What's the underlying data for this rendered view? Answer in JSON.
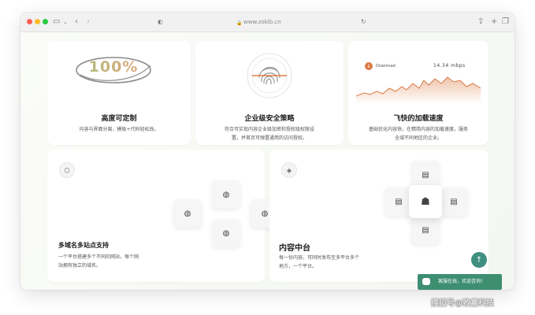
{
  "browser": {
    "url": "www.zoklb.cn",
    "icons": {
      "back": "chevron-left-icon",
      "forward": "chevron-right-icon",
      "share": "share-icon",
      "new_tab": "plus-icon",
      "tabs": "tabs-icon",
      "lock": "lock-icon",
      "reload": "reload-icon",
      "sidebar": "sidebar-icon"
    }
  },
  "cards": {
    "custom": {
      "badge": "100%",
      "title": "高度可定制",
      "desc": "内容与界面分离，模板+代码轻松改。"
    },
    "security": {
      "title": "企业级安全策略",
      "desc_line1": "符合可实现内容企业级加密和授权级权限设",
      "desc_line2": "置，并首页可弹置通用的访问授权。"
    },
    "speed": {
      "legend": "Download",
      "value": "14.34 mbps",
      "title": "飞快的加载速度",
      "desc_line1": "基础优化内容快，在精简内容的加载速度，服务",
      "desc_line2": "全域不同地区的企业。"
    },
    "multisite": {
      "title": "多域名多站点支持",
      "desc_line1": "一个平台搭建多个不同的网站，每个网",
      "desc_line2": "站拥有独立的域名。"
    },
    "cms": {
      "title": "内容中台",
      "desc_line1": "每一份内容，可同时发布至多平台多个",
      "desc_line2": "地方，一个平台。"
    }
  },
  "chat": {
    "label": "客服在线，欢迎咨询！"
  },
  "watermark": "搜狐号@致富科技",
  "colors": {
    "accent": "#3f8f80",
    "badge_start": "#a9c07f",
    "badge_end": "#e9a27a",
    "chart": "#d97a43"
  }
}
